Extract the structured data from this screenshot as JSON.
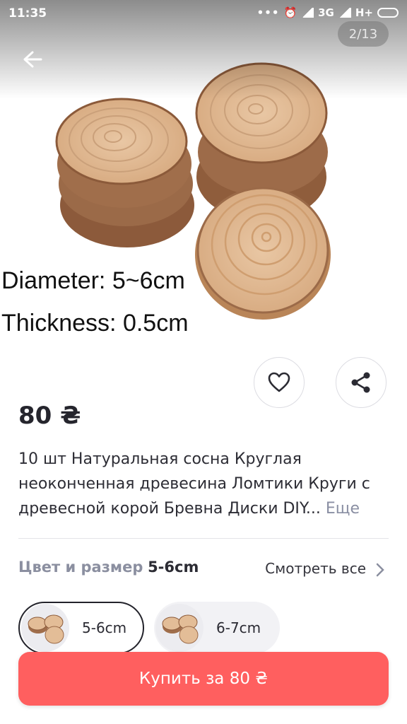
{
  "status": {
    "time": "11:35",
    "network": "3G",
    "network2": "H+"
  },
  "gallery": {
    "counter": "2/13"
  },
  "image_text": {
    "diameter": "Diameter: 5~6cm",
    "thickness": "Thickness: 0.5cm"
  },
  "product": {
    "price": "80 ₴",
    "title": "10 шт Натуральная сосна Круглая неоконченная древесина Ломтики Круги с древесной корой Бревна Диски DIY...",
    "more": "Еще"
  },
  "variant": {
    "label": "Цвет и размер",
    "selected": "5-6cm",
    "see_all": "Смотреть все",
    "options": [
      {
        "label": "5-6cm"
      },
      {
        "label": "6-7cm"
      }
    ]
  },
  "cta": {
    "buy": "Купить за 80 ₴"
  },
  "colors": {
    "buy": "#ff5f5f",
    "text": "#2b2b33",
    "muted": "#8b8fa0"
  }
}
